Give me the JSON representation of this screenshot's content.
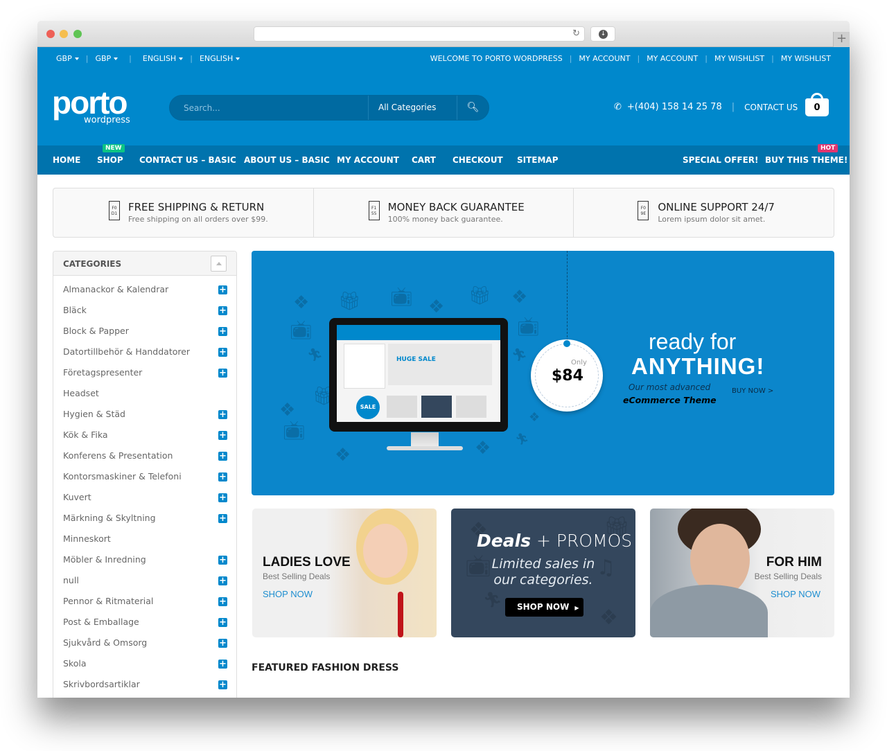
{
  "browser": {
    "url": "",
    "reload_icon": "reload-icon",
    "download_icon": "download-icon",
    "new_tab_icon": "plus-icon"
  },
  "topbar": {
    "currency": [
      "GBP",
      "GBP"
    ],
    "language": [
      "ENGLISH",
      "ENGLISH"
    ],
    "links": [
      "WELCOME TO PORTO WORDPRESS",
      "MY ACCOUNT",
      "MY ACCOUNT",
      "MY WISHLIST",
      "MY WISHLIST"
    ]
  },
  "header": {
    "logo_main": "porto",
    "logo_sub": "wordpress",
    "search_placeholder": "Search...",
    "search_category": "All Categories",
    "phone": "+(404) 158 14 25 78",
    "contact_label": "CONTACT US",
    "cart_count": "0"
  },
  "nav": {
    "items": [
      {
        "label": "HOME"
      },
      {
        "label": "SHOP",
        "badge": "NEW"
      },
      {
        "label": "CONTACT US – BASIC"
      },
      {
        "label": "ABOUT US – BASIC"
      },
      {
        "label": "MY ACCOUNT"
      },
      {
        "label": "CART"
      },
      {
        "label": "CHECKOUT"
      },
      {
        "label": "SITEMAP"
      }
    ],
    "right_items": [
      {
        "label": "SPECIAL OFFER!"
      },
      {
        "label": "BUY THIS THEME!",
        "badge": "HOT"
      }
    ]
  },
  "info_boxes": [
    {
      "icon_text": "F0 D1",
      "title": "FREE SHIPPING & RETURN",
      "subtitle": "Free shipping on all orders over $99."
    },
    {
      "icon_text": "F1 55",
      "title": "MONEY BACK GUARANTEE",
      "subtitle": "100% money back guarantee."
    },
    {
      "icon_text": "F0 9E",
      "title": "ONLINE SUPPORT 24/7",
      "subtitle": "Lorem ipsum dolor sit amet."
    }
  ],
  "sidebar": {
    "title": "CATEGORIES",
    "items": [
      {
        "label": "Almanackor & Kalendrar",
        "expandable": true
      },
      {
        "label": "Bläck",
        "expandable": true
      },
      {
        "label": "Block & Papper",
        "expandable": true
      },
      {
        "label": "Datortillbehör & Handdatorer",
        "expandable": true
      },
      {
        "label": "Företagspresenter",
        "expandable": true
      },
      {
        "label": "Headset",
        "expandable": false
      },
      {
        "label": "Hygien & Städ",
        "expandable": true
      },
      {
        "label": "Kök & Fika",
        "expandable": true
      },
      {
        "label": "Konferens & Presentation",
        "expandable": true
      },
      {
        "label": "Kontorsmaskiner & Telefoni",
        "expandable": true
      },
      {
        "label": "Kuvert",
        "expandable": true
      },
      {
        "label": "Märkning & Skyltning",
        "expandable": true
      },
      {
        "label": "Minneskort",
        "expandable": false
      },
      {
        "label": "Möbler & Inredning",
        "expandable": true
      },
      {
        "label": "null",
        "expandable": true
      },
      {
        "label": "Pennor & Ritmaterial",
        "expandable": true
      },
      {
        "label": "Post & Emballage",
        "expandable": true
      },
      {
        "label": "Sjukvård & Omsorg",
        "expandable": true
      },
      {
        "label": "Skola",
        "expandable": true
      },
      {
        "label": "Skrivbordsartiklar",
        "expandable": true
      }
    ]
  },
  "hero": {
    "screen_banner": "HUGE SALE",
    "screen_sale": "SALE",
    "tag_only": "Only",
    "tag_price": "$84",
    "headline_1": "ready for",
    "headline_2": "ANYTHING!",
    "tagline_1": "Our most advanced",
    "tagline_2": "eCommerce Theme",
    "cta": "BUY NOW >"
  },
  "promos": {
    "ladies": {
      "title": "LADIES LOVE",
      "subtitle": "Best Selling Deals",
      "cta": "SHOP NOW"
    },
    "deals": {
      "title_bold": "Deals",
      "title_rest": " + PROMOS",
      "line1": "Limited sales in",
      "line2": "our categories.",
      "cta": "SHOP NOW"
    },
    "him": {
      "title": "FOR HIM",
      "subtitle": "Best Selling Deals",
      "cta": "SHOP NOW"
    }
  },
  "featured_title": "FEATURED FASHION DRESS",
  "colors": {
    "brand_blue": "#0088cc",
    "nav_blue": "#0073ad",
    "badge_new": "#0cc485",
    "badge_hot": "#e2356f",
    "deals_bg": "#34475d"
  }
}
